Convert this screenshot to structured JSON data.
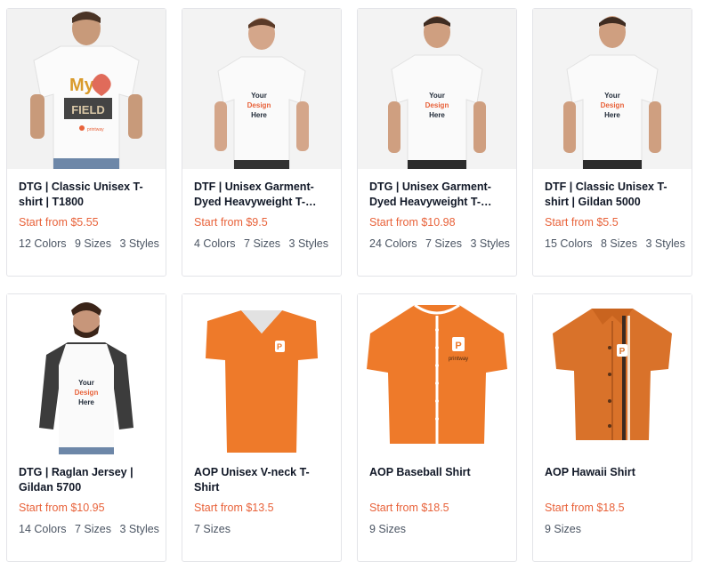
{
  "products": [
    {
      "title": "DTG | Classic Unisex T-shirt | T1800",
      "price": "Start from $5.55",
      "colors": "12 Colors",
      "sizes": "9 Sizes",
      "styles": "3 Styles",
      "image": "model-white-tshirt-my-heart-print"
    },
    {
      "title": "DTF | Unisex Garment-Dyed Heavyweight T-Shir...",
      "price": "Start from $9.5",
      "colors": "4 Colors",
      "sizes": "7 Sizes",
      "styles": "3 Styles",
      "image": "model-white-tshirt-your-design-here"
    },
    {
      "title": "DTG | Unisex Garment-Dyed Heavyweight T-Shir...",
      "price": "Start from $10.98",
      "colors": "24 Colors",
      "sizes": "7 Sizes",
      "styles": "3 Styles",
      "image": "model-white-tshirt-your-design-here"
    },
    {
      "title": "DTF | Classic Unisex T-shirt | Gildan 5000",
      "price": "Start from $5.5",
      "colors": "15 Colors",
      "sizes": "8 Sizes",
      "styles": "3 Styles",
      "image": "model-white-tshirt-your-design-here"
    },
    {
      "title": "DTG | Raglan Jersey | Gildan 5700",
      "price": "Start from $10.95",
      "colors": "14 Colors",
      "sizes": "7 Sizes",
      "styles": "3 Styles",
      "image": "model-raglan-shirt-your-design-here"
    },
    {
      "title": "AOP Unisex V-neck T-Shirt",
      "price": "Start from $13.5",
      "sizes": "7 Sizes",
      "image": "orange-vneck-tshirt"
    },
    {
      "title": "AOP Baseball Shirt",
      "price": "Start from $18.5",
      "sizes": "9 Sizes",
      "image": "orange-baseball-jersey"
    },
    {
      "title": "AOP Hawaii Shirt",
      "price": "Start from $18.5",
      "sizes": "9 Sizes",
      "image": "orange-hawaii-shirt"
    }
  ],
  "mockup_text": {
    "line1": "Your",
    "line2": "Design",
    "line3": "Here",
    "brand": "printway"
  },
  "colors": {
    "price": "#e8623a",
    "orange_product": "#ee7a2a",
    "design_accent": "#e8623a"
  }
}
